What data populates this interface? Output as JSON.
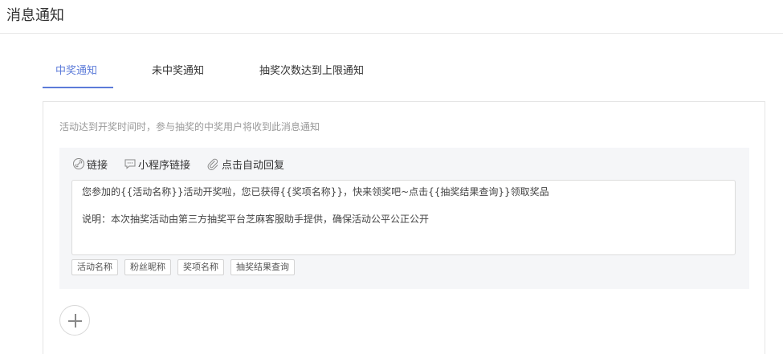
{
  "page": {
    "title": "消息通知"
  },
  "tabs": [
    {
      "label": "中奖通知",
      "active": true
    },
    {
      "label": "未中奖通知",
      "active": false
    },
    {
      "label": "抽奖次数达到上限通知",
      "active": false
    }
  ],
  "panel": {
    "description": "活动达到开奖时间时，参与抽奖的中奖用户将收到此消息通知",
    "toolbar": {
      "link": {
        "label": "链接",
        "icon": "link-circle-icon"
      },
      "miniprogram_link": {
        "label": "小程序链接",
        "icon": "message-square-icon"
      },
      "auto_reply": {
        "label": "点击自动回复",
        "icon": "paperclip-icon"
      }
    },
    "message": {
      "line1": "您参加的{{活动名称}}活动开奖啦，您已获得{{奖项名称}}，快来领奖吧~点击{{抽奖结果查询}}领取奖品",
      "line2": "说明：本次抽奖活动由第三方抽奖平台芝麻客服助手提供，确保活动公平公正公开"
    },
    "tags": [
      "活动名称",
      "粉丝昵称",
      "奖项名称",
      "抽奖结果查询"
    ],
    "add_icon": "plus-icon"
  },
  "colors": {
    "accent": "#5c7bd9",
    "editor_bg": "#f5f6f8",
    "muted_text": "#999999"
  }
}
